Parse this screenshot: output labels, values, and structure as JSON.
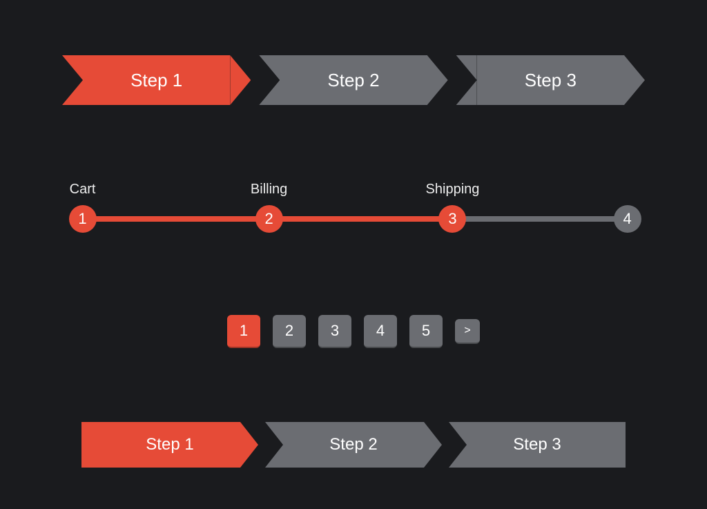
{
  "colors": {
    "accent": "#e64b37",
    "inactive": "#6b6d72",
    "background": "#1a1b1e"
  },
  "arrowStepsA": {
    "active": 0,
    "items": [
      {
        "label": "Step 1"
      },
      {
        "label": "Step 2"
      },
      {
        "label": "Step 3"
      }
    ]
  },
  "circleSteps": {
    "reached": 2,
    "items": [
      {
        "number": "1",
        "label": "Cart"
      },
      {
        "number": "2",
        "label": "Billing"
      },
      {
        "number": "3",
        "label": "Shipping"
      },
      {
        "number": "4",
        "label": ""
      }
    ]
  },
  "pagination": {
    "active": 0,
    "nextGlyph": ">",
    "pages": [
      "1",
      "2",
      "3",
      "4",
      "5"
    ]
  },
  "arrowStepsB": {
    "active": 0,
    "items": [
      {
        "label": "Step 1"
      },
      {
        "label": "Step 2"
      },
      {
        "label": "Step 3"
      }
    ]
  }
}
